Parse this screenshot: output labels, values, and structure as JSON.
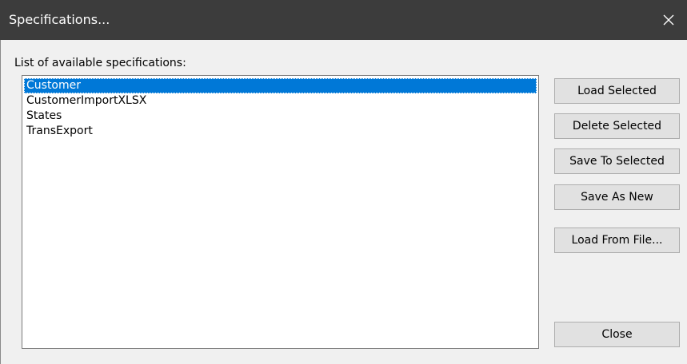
{
  "window": {
    "title": "Specifications...",
    "close_glyph": "✕"
  },
  "list": {
    "label": "List of available specifications:",
    "items": [
      {
        "label": "Customer",
        "selected": true
      },
      {
        "label": "CustomerImportXLSX",
        "selected": false
      },
      {
        "label": "States",
        "selected": false
      },
      {
        "label": "TransExport",
        "selected": false
      }
    ]
  },
  "buttons": {
    "load_selected": "Load Selected",
    "delete_selected": "Delete Selected",
    "save_to_selected": "Save To Selected",
    "save_as_new": "Save As New",
    "load_from_file": "Load From File...",
    "close": "Close"
  },
  "colors": {
    "titlebar": "#3c3c3c",
    "selection": "#0078d7",
    "dialog_bg": "#f0f0f0",
    "button_bg": "#e1e1e1"
  }
}
